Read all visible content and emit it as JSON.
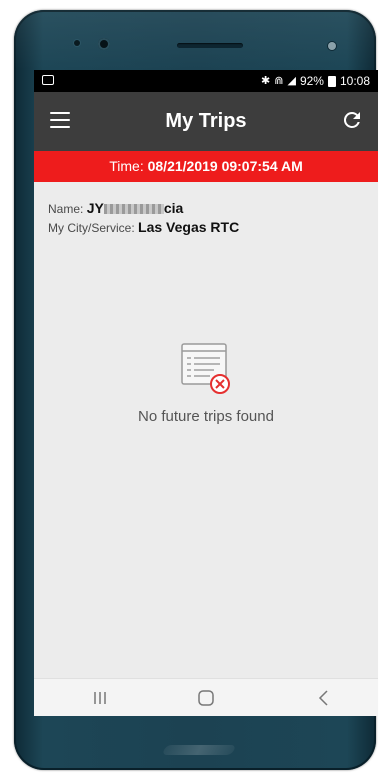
{
  "status_bar": {
    "battery": "92%",
    "time": "10:08",
    "icons": [
      "image-notification-icon",
      "bluetooth-icon",
      "wifi-icon",
      "signal-icon",
      "battery-icon"
    ]
  },
  "app_bar": {
    "title": "My Trips",
    "menu_icon": "hamburger-menu-icon",
    "refresh_icon": "refresh-icon"
  },
  "time_banner": {
    "label": "Time:",
    "value": "08/21/2019 09:07:54 AM",
    "background": "#ee1c1c"
  },
  "user": {
    "name_label": "Name:",
    "name_prefix": "JY",
    "name_suffix": "cia",
    "city_label": "My City/Service:",
    "city_value": "Las Vegas RTC"
  },
  "empty_state": {
    "icon": "no-trips-document-icon",
    "message": "No future trips found"
  },
  "nav_bar": {
    "recent_icon": "recent-apps-icon",
    "home_icon": "home-icon",
    "back_icon": "back-icon"
  },
  "colors": {
    "app_bar": "#3d3d3d",
    "content_background": "#ececec",
    "phone_body": "#1c4252"
  }
}
